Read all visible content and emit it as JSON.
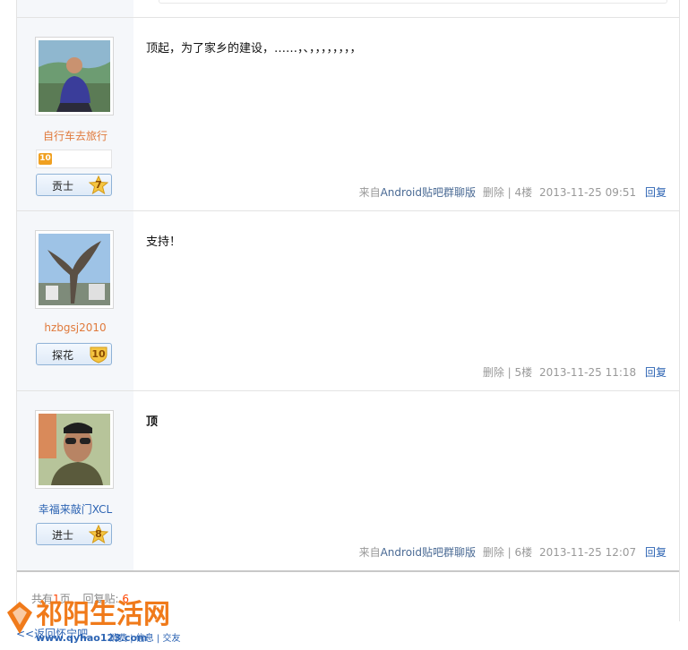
{
  "posts": [
    {
      "username": "自行车去旅行",
      "level_num": "10",
      "rank_title": "贡士",
      "rank_level": "7",
      "content": "顶起，为了家乡的建设，……，、，，，，，，，，",
      "source_prefix": "来自",
      "source_app": "Android贴吧群聊版",
      "delete": "删除",
      "separator": "|",
      "floor": "4楼",
      "time": "2013-11-25 09:51",
      "reply": "回复"
    },
    {
      "username": "hzbgsj2010",
      "rank_title": "探花",
      "rank_level": "10",
      "content": "支持！",
      "delete": "删除",
      "separator": "|",
      "floor": "5楼",
      "time": "2013-11-25 11:18",
      "reply": "回复"
    },
    {
      "username": "幸福来敲门XCL",
      "rank_title": "进士",
      "rank_level": "8",
      "content": "顶",
      "source_prefix": "来自",
      "source_app": "Android贴吧群聊版",
      "delete": "删除",
      "separator": "|",
      "floor": "6楼",
      "time": "2013-11-25 12:07",
      "reply": "回复"
    }
  ],
  "pager": {
    "total_prefix": "共有",
    "pages": "1",
    "pages_suffix": "页",
    "reply_label": "回复贴:",
    "replies": "6"
  },
  "back_link": "<<返回怀宁吧",
  "watermark": {
    "brand": "祁阳生活网",
    "url": "www.qyhao123.com",
    "tags": "消费 | 信息 | 交友"
  },
  "colors": {
    "username": "#e07a3c",
    "link": "#2d64b3",
    "sidebar": "#f5f7fa"
  }
}
